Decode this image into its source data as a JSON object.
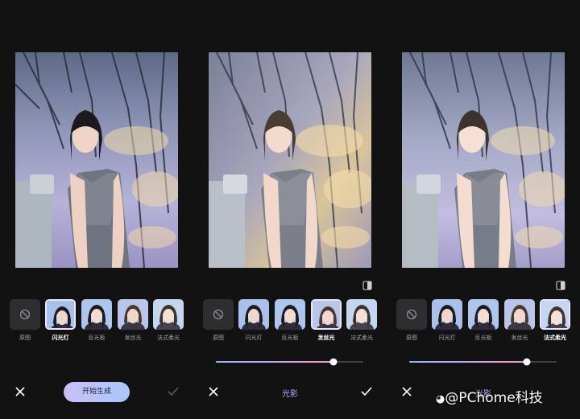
{
  "filters": [
    {
      "key": "original",
      "label": "原图"
    },
    {
      "key": "flash",
      "label": "闪光灯"
    },
    {
      "key": "reflector",
      "label": "反光板"
    },
    {
      "key": "hairlight",
      "label": "发丝光"
    },
    {
      "key": "french",
      "label": "法式柔光"
    }
  ],
  "panels": [
    {
      "selected_filter": "flash",
      "generate_label": "开始生成"
    },
    {
      "selected_filter": "hairlight",
      "mode_label": "光影",
      "slider_value": 0.8
    },
    {
      "selected_filter": "french",
      "mode_label": "光影",
      "slider_value": 0.8
    }
  ],
  "watermark": "@PChome科技",
  "colors": {
    "accent": "#b8a6ff",
    "background": "#121212"
  }
}
